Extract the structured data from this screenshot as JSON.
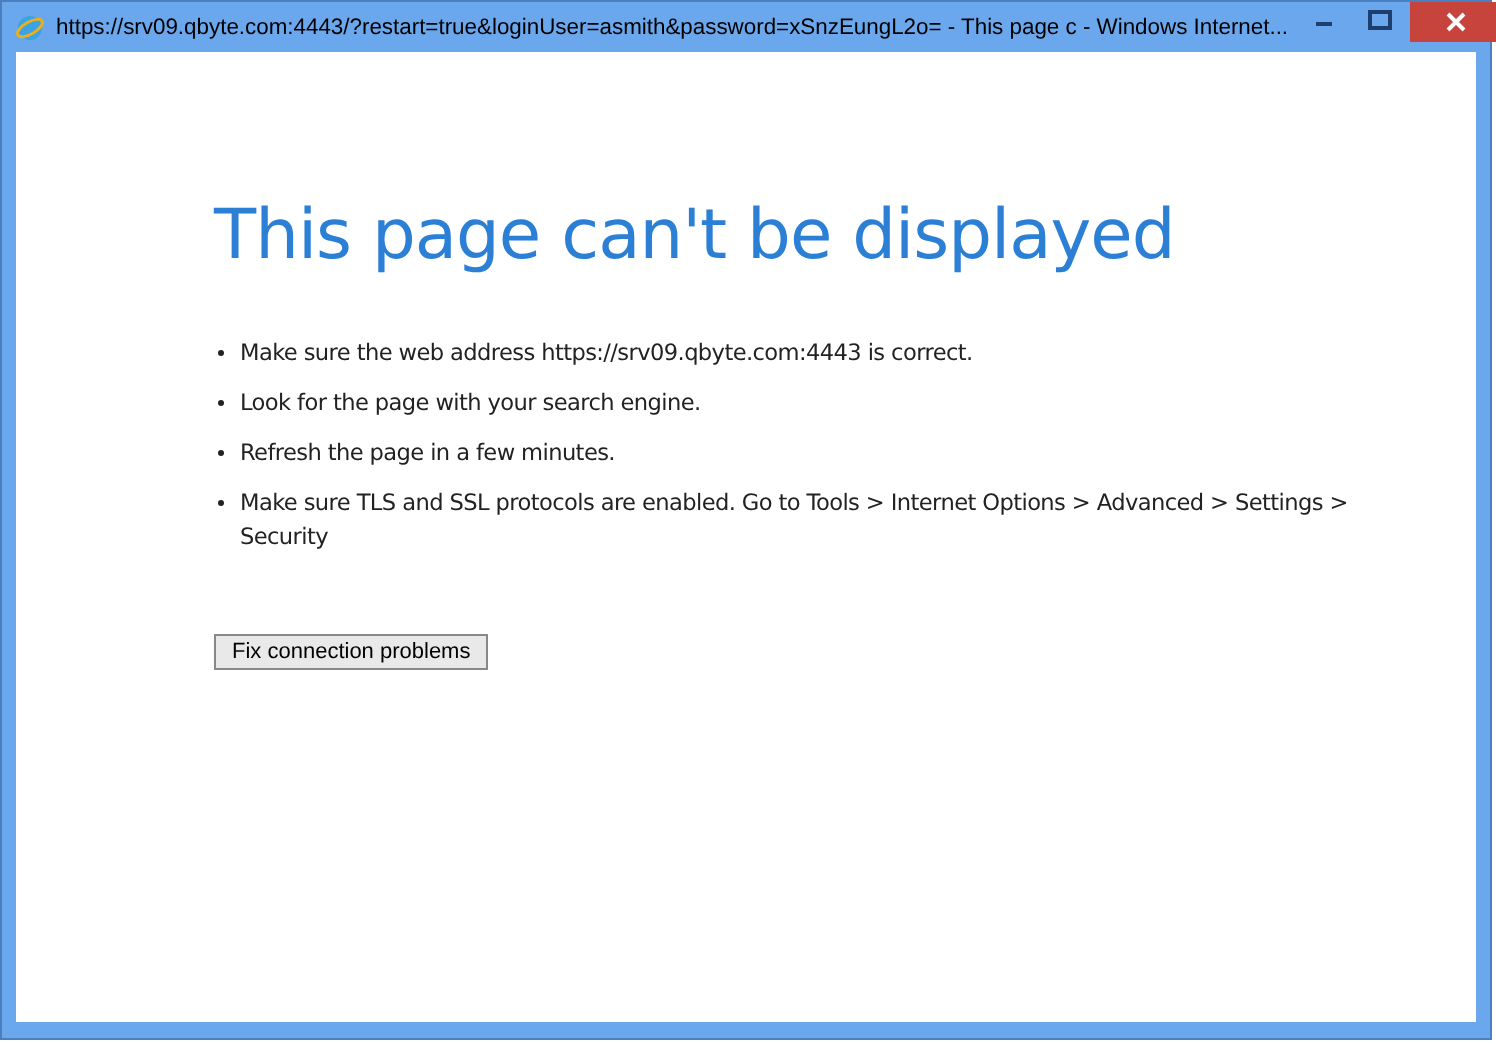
{
  "window": {
    "title": "https://srv09.qbyte.com:4443/?restart=true&loginUser=asmith&password=xSnzEungL2o= - This page c - Windows Internet..."
  },
  "page": {
    "heading": "This page can't be displayed",
    "bullets": [
      "Make sure the web address https://srv09.qbyte.com:4443 is correct.",
      "Look for the page with your search engine.",
      "Refresh the page in a few minutes.",
      "Make sure TLS and SSL protocols are enabled. Go to Tools > Internet Options > Advanced > Settings > Security"
    ],
    "button": "Fix connection problems"
  }
}
